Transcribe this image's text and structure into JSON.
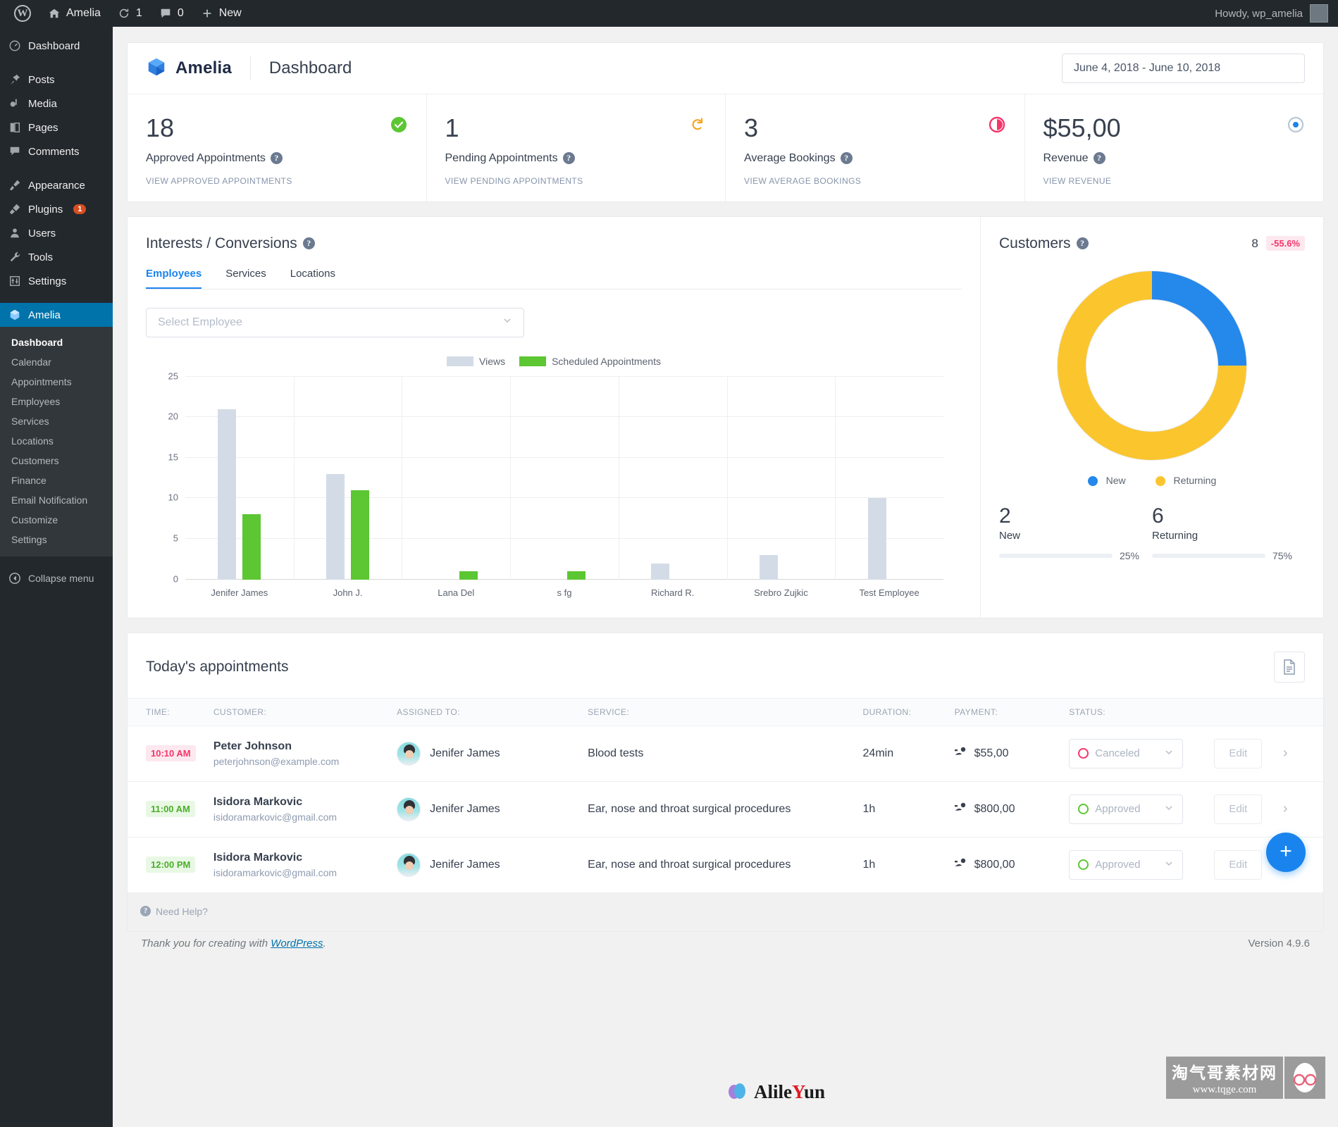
{
  "adminbar": {
    "logo_icon": "wordpress-logo-icon",
    "site_name": "Amelia",
    "updates_icon": "updates-icon",
    "updates_count": "1",
    "comments_icon": "comments-icon",
    "comments_count": "0",
    "new_icon": "plus-icon",
    "new_label": "New",
    "howdy": "Howdy, wp_amelia"
  },
  "sidebar": {
    "items": [
      {
        "label": "Dashboard",
        "icon": "dashboard-icon"
      },
      {
        "label": "Posts",
        "icon": "pin-icon"
      },
      {
        "label": "Media",
        "icon": "media-icon"
      },
      {
        "label": "Pages",
        "icon": "pages-icon"
      },
      {
        "label": "Comments",
        "icon": "comment-icon"
      },
      {
        "label": "Appearance",
        "icon": "brush-icon"
      },
      {
        "label": "Plugins",
        "icon": "plug-icon",
        "badge": "1"
      },
      {
        "label": "Users",
        "icon": "user-icon"
      },
      {
        "label": "Tools",
        "icon": "wrench-icon"
      },
      {
        "label": "Settings",
        "icon": "sliders-icon"
      },
      {
        "label": "Amelia",
        "icon": "amelia-logo-icon",
        "current": true
      }
    ],
    "submenu": [
      {
        "label": "Dashboard",
        "active": true
      },
      {
        "label": "Calendar"
      },
      {
        "label": "Appointments"
      },
      {
        "label": "Employees"
      },
      {
        "label": "Services"
      },
      {
        "label": "Locations"
      },
      {
        "label": "Customers"
      },
      {
        "label": "Finance"
      },
      {
        "label": "Email Notification"
      },
      {
        "label": "Customize"
      },
      {
        "label": "Settings"
      }
    ],
    "collapse_label": "Collapse menu"
  },
  "header": {
    "brand": "Amelia",
    "page_title": "Dashboard",
    "date_range": "June 4, 2018 - June 10, 2018"
  },
  "stats": [
    {
      "value": "18",
      "label": "Approved Appointments",
      "link": "VIEW APPROVED APPOINTMENTS",
      "icon": "check-circle-icon",
      "color": "#5cc633"
    },
    {
      "value": "1",
      "label": "Pending Appointments",
      "link": "VIEW PENDING APPOINTMENTS",
      "icon": "refresh-icon",
      "color": "#f5a623"
    },
    {
      "value": "3",
      "label": "Average Bookings",
      "link": "VIEW AVERAGE BOOKINGS",
      "icon": "pie-icon",
      "color": "#f5366a"
    },
    {
      "value": "$55,00",
      "label": "Revenue",
      "link": "VIEW REVENUE",
      "icon": "dollar-circle-icon",
      "color": "#1a84ee"
    }
  ],
  "interests": {
    "title": "Interests / Conversions",
    "tabs": [
      {
        "label": "Employees",
        "active": true
      },
      {
        "label": "Services",
        "active": false
      },
      {
        "label": "Locations",
        "active": false
      }
    ],
    "select_placeholder": "Select Employee"
  },
  "customers": {
    "title": "Customers",
    "total": "8",
    "delta": "-55.6%",
    "legend": [
      {
        "label": "New",
        "color": "#2588eb"
      },
      {
        "label": "Returning",
        "color": "#fbc52d"
      }
    ],
    "splits": [
      {
        "value": "2",
        "label": "New",
        "pct": "25%",
        "pct_num": 25,
        "color": "#2588eb"
      },
      {
        "value": "6",
        "label": "Returning",
        "pct": "75%",
        "pct_num": 75,
        "color": "#fbc52d"
      }
    ]
  },
  "appointments": {
    "title": "Today's appointments",
    "export_icon": "export-file-icon",
    "columns": [
      "TIME:",
      "CUSTOMER:",
      "ASSIGNED TO:",
      "SERVICE:",
      "DURATION:",
      "PAYMENT:",
      "STATUS:",
      "",
      ""
    ],
    "rows": [
      {
        "time": "10:10 AM",
        "time_state": "canceled",
        "customer": "Peter Johnson",
        "email": "peterjohnson@example.com",
        "employee": "Jenifer James",
        "service": "Blood tests",
        "duration": "24min",
        "payment": "$55,00",
        "status": "Canceled",
        "status_state": "canceled",
        "edit_label": "Edit"
      },
      {
        "time": "11:00 AM",
        "time_state": "approved",
        "customer": "Isidora Markovic",
        "email": "isidoramarkovic@gmail.com",
        "employee": "Jenifer James",
        "service": "Ear, nose and throat surgical procedures",
        "duration": "1h",
        "payment": "$800,00",
        "status": "Approved",
        "status_state": "approved",
        "edit_label": "Edit"
      },
      {
        "time": "12:00 PM",
        "time_state": "approved",
        "customer": "Isidora Markovic",
        "email": "isidoramarkovic@gmail.com",
        "employee": "Jenifer James",
        "service": "Ear, nose and throat surgical procedures",
        "duration": "1h",
        "payment": "$800,00",
        "status": "Approved",
        "status_state": "approved",
        "edit_label": "Edit"
      }
    ],
    "need_help": "Need Help?"
  },
  "fab": {
    "icon": "plus-icon",
    "label": "+"
  },
  "footer": {
    "thanks_prefix": "Thank you for creating with ",
    "wordpress_link": "WordPress",
    "thanks_suffix": ".",
    "version": "Version 4.9.6"
  },
  "watermarks": {
    "center_text_a": "Alile",
    "center_text_r": "Y",
    "center_text_b": "un",
    "right_cn": "淘气哥素材网",
    "right_url": "www.tqge.com"
  },
  "chart_data": {
    "type": "bar",
    "title": "Interests / Conversions",
    "categories": [
      "Jenifer James",
      "John J.",
      "Lana Del",
      "s fg",
      "Richard  R.",
      "Srebro Zujkic",
      "Test Employee"
    ],
    "series": [
      {
        "name": "Views",
        "color": "#d3dce6",
        "values": [
          21,
          13,
          0,
          0,
          2,
          3,
          10
        ]
      },
      {
        "name": "Scheduled Appointments",
        "color": "#5cc633",
        "values": [
          8,
          11,
          1,
          1,
          0,
          0,
          0
        ]
      }
    ],
    "ylim": [
      0,
      25
    ],
    "yticks": [
      0,
      5,
      10,
      15,
      20,
      25
    ],
    "xlabel": "",
    "ylabel": "",
    "grid": true,
    "legend_position": "top-center"
  },
  "donut_data": {
    "type": "pie",
    "title": "Customers",
    "labels": [
      "New",
      "Returning"
    ],
    "values": [
      2,
      6
    ],
    "percents": [
      25,
      75
    ],
    "colors": [
      "#2588eb",
      "#fbc52d"
    ],
    "total": 8
  }
}
